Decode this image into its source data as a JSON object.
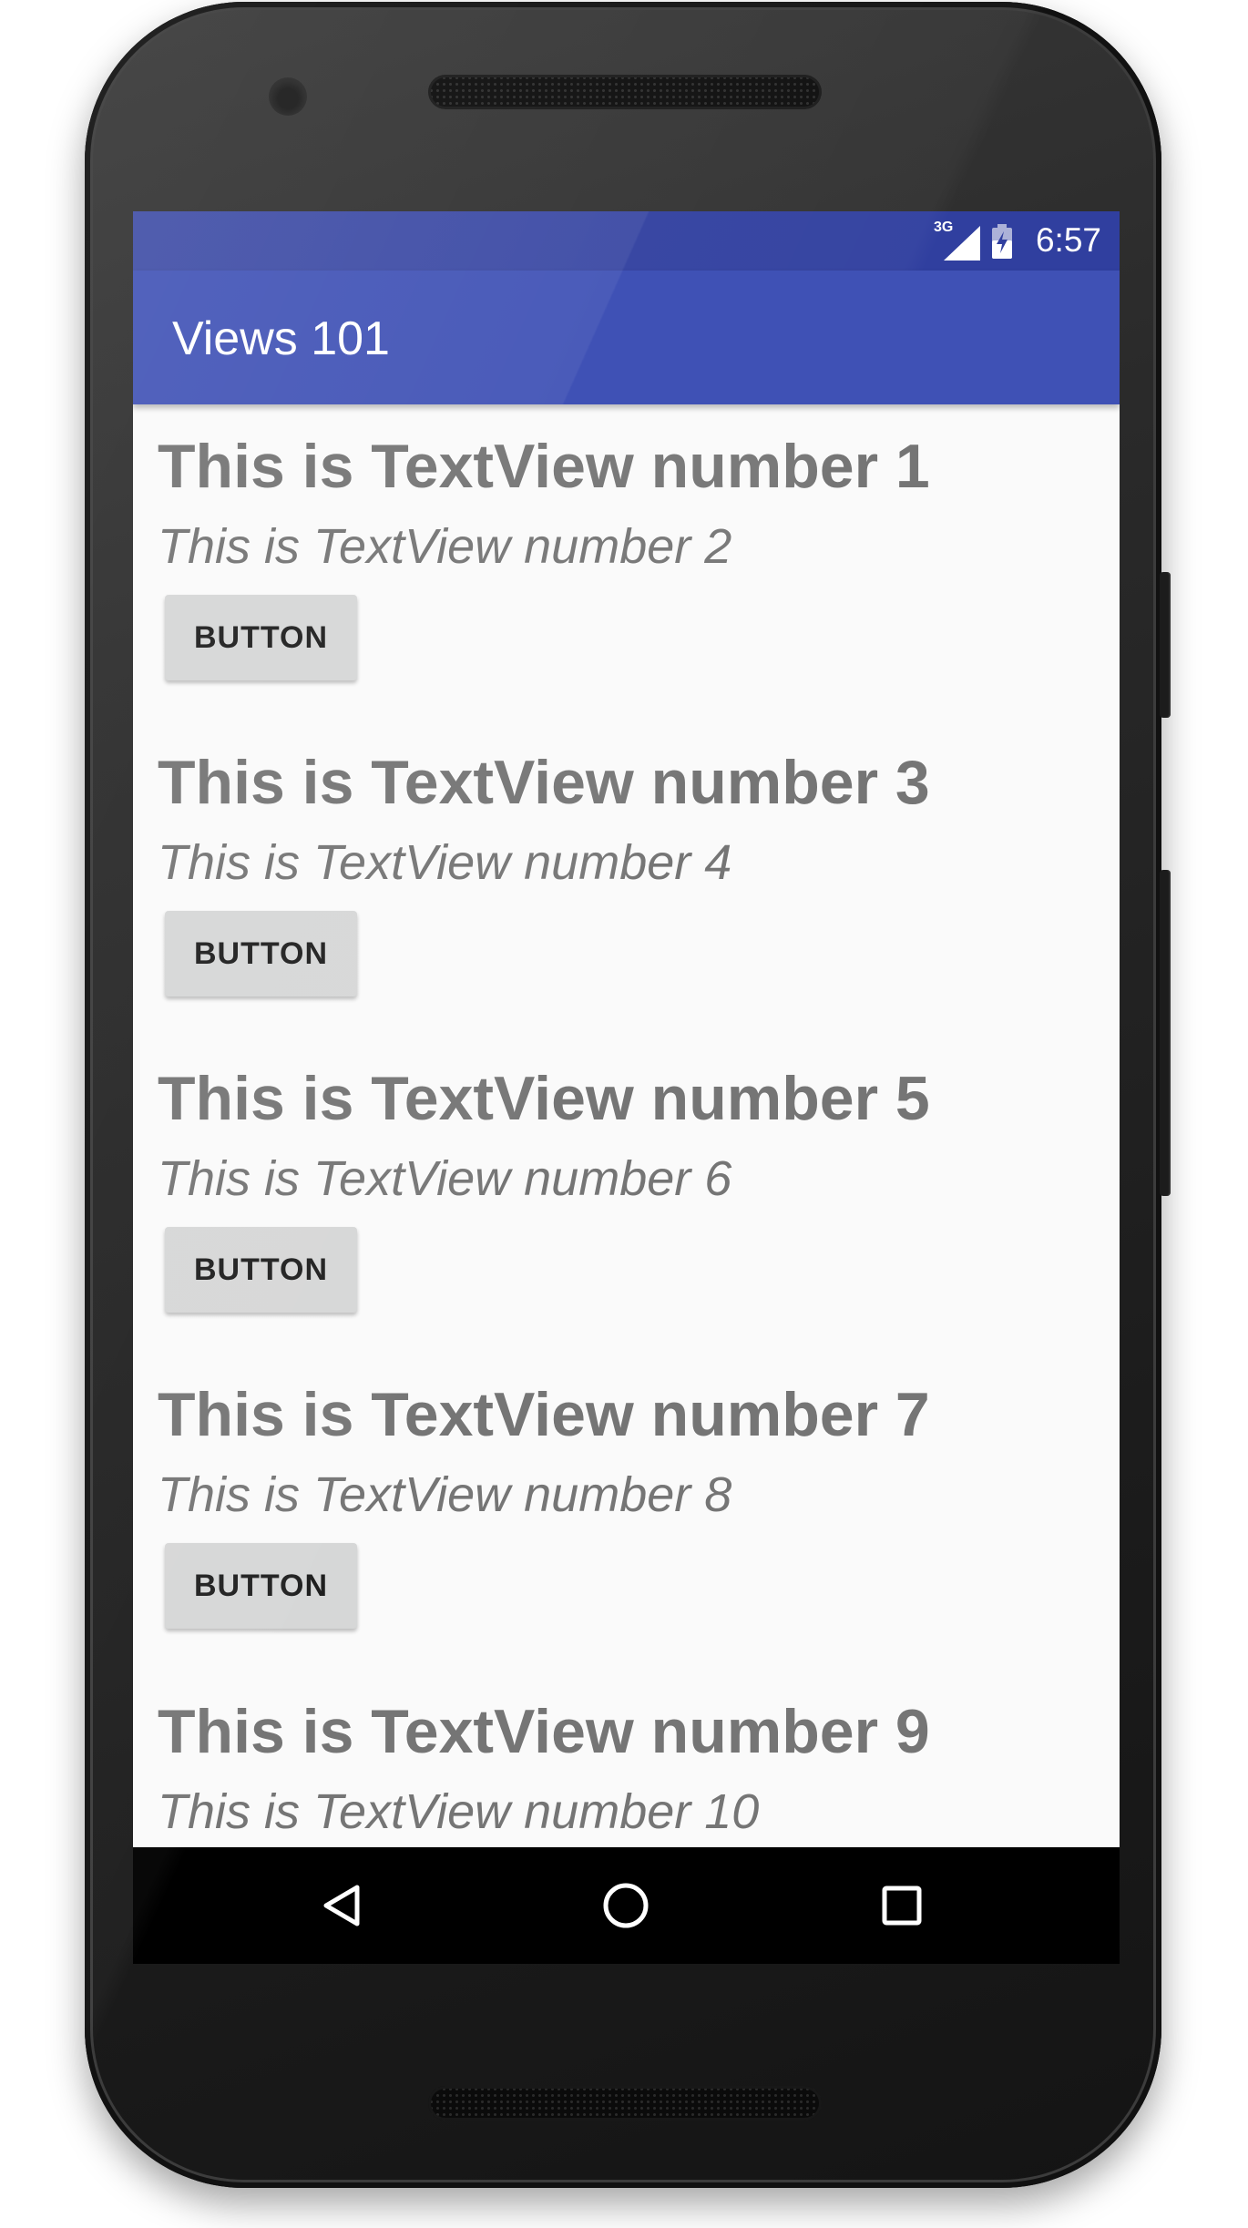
{
  "status_bar": {
    "time": "6:57",
    "network_type": "3G",
    "icons": [
      "signal-icon",
      "battery-charging-icon"
    ]
  },
  "app_bar": {
    "title": "Views 101"
  },
  "content": {
    "groups": [
      {
        "heading": "This is TextView number 1",
        "subheading": "This is TextView number 2",
        "button": "BUTTON"
      },
      {
        "heading": "This is TextView number 3",
        "subheading": "This is TextView number 4",
        "button": "BUTTON"
      },
      {
        "heading": "This is TextView number 5",
        "subheading": "This is TextView number 6",
        "button": "BUTTON"
      },
      {
        "heading": "This is TextView number 7",
        "subheading": "This is TextView number 8",
        "button": "BUTTON"
      },
      {
        "heading": "This is TextView number 9",
        "subheading": "This is TextView number 10"
      }
    ]
  },
  "nav_bar": {
    "icons": [
      "back-icon",
      "home-icon",
      "recents-icon"
    ]
  },
  "colors": {
    "primary": "#3f51b5",
    "primary_dark": "#303f9f",
    "text": "#757575",
    "button": "#d6d7d7",
    "background": "#fafafa"
  }
}
